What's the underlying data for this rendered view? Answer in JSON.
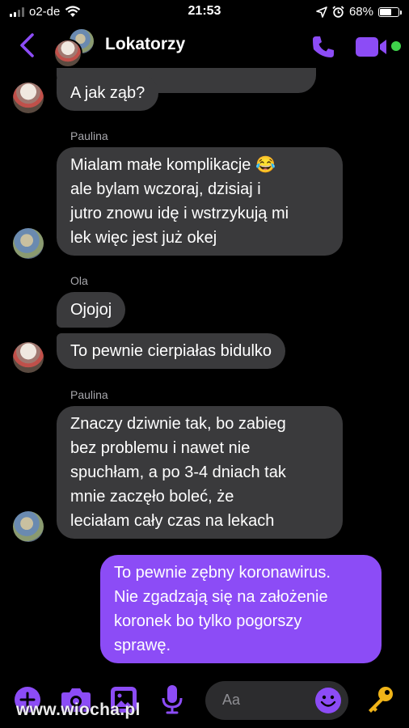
{
  "status_bar": {
    "carrier": "o2-de",
    "time": "21:53",
    "battery": "68%",
    "battery_level": 0.68,
    "icons": [
      "signal-icon",
      "wifi-icon",
      "location-icon",
      "alarm-icon",
      "battery-icon"
    ]
  },
  "header": {
    "title": "Lokatorzy",
    "icons": [
      "back-chevron-icon",
      "phone-icon",
      "video-camera-icon"
    ],
    "accent_color": "#8c4cf6",
    "online_color": "#3fd24b"
  },
  "messages": [
    {
      "sender": "",
      "text": "A jak ząb?",
      "from_me": false
    },
    {
      "sender": "Paulina",
      "lines": [
        "Mialam małe komplikacje 😂",
        "ale bylam wczoraj, dzisiaj i",
        "jutro znowu idę i wstrzykują mi",
        "lek więc jest już okej"
      ],
      "from_me": false
    },
    {
      "sender": "Ola",
      "text": "Ojojoj",
      "from_me": false
    },
    {
      "sender": "",
      "text": "To pewnie cierpiałas bidulko",
      "from_me": false
    },
    {
      "sender": "Paulina",
      "lines": [
        "Znaczy dziwnie tak, bo zabieg",
        "bez problemu i nawet nie",
        "spuchłam, a po 3-4 dniach tak",
        "mnie zaczęło boleć, że",
        "leciałam cały czas na lekach"
      ],
      "from_me": false
    },
    {
      "sender": "",
      "lines": [
        "To pewnie zębny koronawirus.",
        "Nie zgadzają się na założenie",
        "koronek bo tylko pogorszy",
        "sprawę."
      ],
      "from_me": true
    }
  ],
  "composer": {
    "placeholder": "Aa",
    "icons": [
      "plus-icon",
      "camera-icon",
      "photo-icon",
      "microphone-icon",
      "emoji-icon",
      "key-icon"
    ]
  },
  "watermark": "www.wiocha.pl",
  "colors": {
    "bubble_other": "#3a3a3c",
    "bubble_me": "#8c4cf6",
    "background": "#000000"
  }
}
